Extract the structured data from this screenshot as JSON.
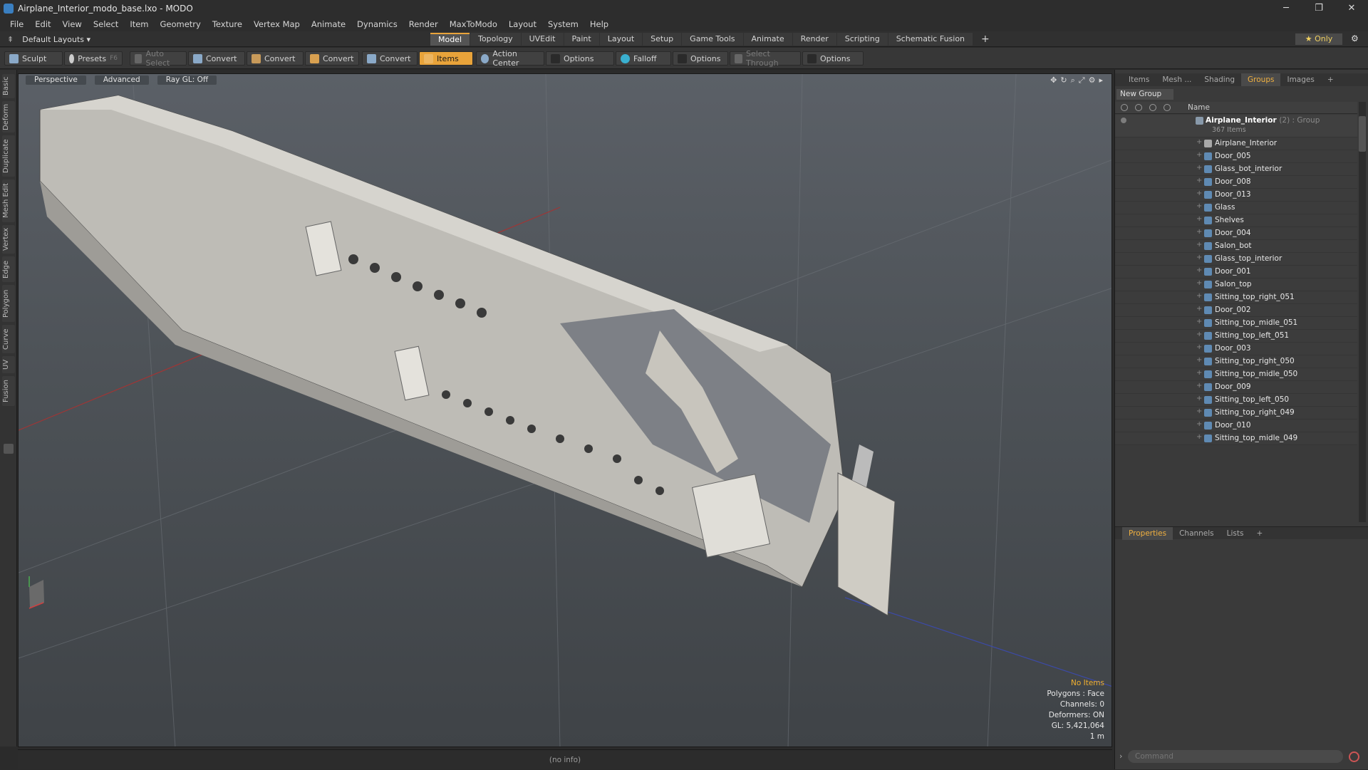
{
  "window": {
    "title": "Airplane_Interior_modo_base.lxo - MODO",
    "minimize": "─",
    "restore": "❐",
    "close": "✕"
  },
  "menu": [
    "File",
    "Edit",
    "View",
    "Select",
    "Item",
    "Geometry",
    "Texture",
    "Vertex Map",
    "Animate",
    "Dynamics",
    "Render",
    "MaxToModo",
    "Layout",
    "System",
    "Help"
  ],
  "layout": {
    "selector": "Default Layouts ▾",
    "tabs": [
      "Model",
      "Topology",
      "UVEdit",
      "Paint",
      "Layout",
      "Setup",
      "Game Tools",
      "Animate",
      "Render",
      "Scripting",
      "Schematic Fusion"
    ],
    "active_tab": "Model",
    "add": "+",
    "only": "★ Only",
    "gear": "⚙"
  },
  "toolbar": {
    "sculpt": "Sculpt",
    "presets": "Presets",
    "presets_key": "F6",
    "auto_select": "Auto Select",
    "convert": "Convert",
    "items": "Items",
    "action_center": "Action Center",
    "options": "Options",
    "falloff": "Falloff",
    "select_through": "Select Through"
  },
  "left_tabs": [
    "Basic",
    "Deform",
    "Duplicate",
    "Mesh Edit",
    "Vertex",
    "Edge",
    "Polygon",
    "Curve",
    "UV",
    "Fusion"
  ],
  "viewport": {
    "perspective": "Perspective",
    "advanced": "Advanced",
    "raygl": "Ray GL: Off",
    "stats": {
      "items": "No Items",
      "polygons": "Polygons : Face",
      "channels": "Channels: 0",
      "deformers": "Deformers: ON",
      "gl": "GL: 5,421,064",
      "scale": "1 m"
    }
  },
  "status": {
    "info": "(no info)"
  },
  "panel": {
    "tabs": [
      "Items",
      "Mesh ...",
      "Shading",
      "Groups",
      "Images"
    ],
    "active_tab": "Groups",
    "new_group": "New Group",
    "name_col": "Name",
    "group": {
      "name": "Airplane_Interior",
      "suffix": "(2) : Group",
      "count": "367 Items"
    },
    "items": [
      "Airplane_Interior",
      "Door_005",
      "Glass_bot_interior",
      "Door_008",
      "Door_013",
      "Glass",
      "Shelves",
      "Door_004",
      "Salon_bot",
      "Glass_top_interior",
      "Door_001",
      "Salon_top",
      "Sitting_top_right_051",
      "Door_002",
      "Sitting_top_midle_051",
      "Sitting_top_left_051",
      "Door_003",
      "Sitting_top_right_050",
      "Sitting_top_midle_050",
      "Door_009",
      "Sitting_top_left_050",
      "Sitting_top_right_049",
      "Door_010",
      "Sitting_top_midle_049"
    ],
    "bottom_tabs": [
      "Properties",
      "Channels",
      "Lists"
    ],
    "bottom_active": "Properties",
    "command_placeholder": "Command"
  }
}
